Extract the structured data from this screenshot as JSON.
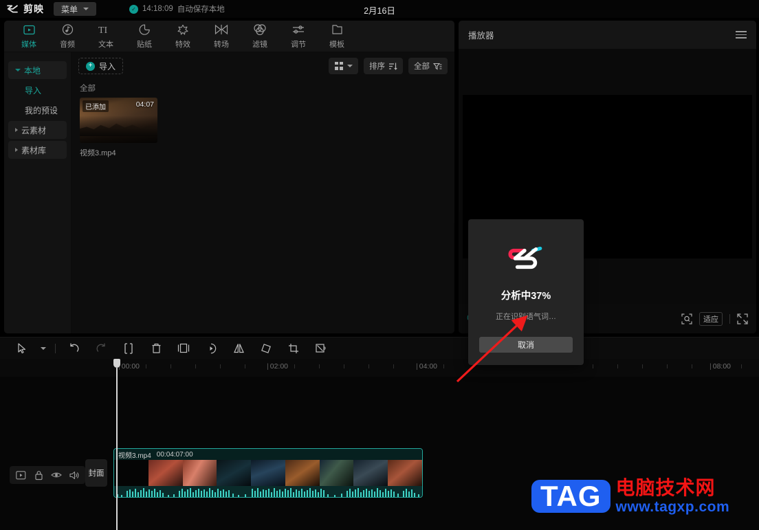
{
  "titlebar": {
    "app_name": "剪映",
    "menu_label": "菜单",
    "save_time": "14:18:09",
    "save_status": "自动保存本地",
    "date": "2月16日"
  },
  "tabs": [
    {
      "label": "媒体",
      "icon": "media-icon",
      "active": true
    },
    {
      "label": "音频",
      "icon": "audio-icon",
      "active": false
    },
    {
      "label": "文本",
      "icon": "text-icon",
      "active": false
    },
    {
      "label": "贴纸",
      "icon": "sticker-icon",
      "active": false
    },
    {
      "label": "特效",
      "icon": "effects-icon",
      "active": false
    },
    {
      "label": "转场",
      "icon": "transition-icon",
      "active": false
    },
    {
      "label": "滤镜",
      "icon": "filter-icon",
      "active": false
    },
    {
      "label": "调节",
      "icon": "adjust-icon",
      "active": false
    },
    {
      "label": "模板",
      "icon": "template-icon",
      "active": false
    }
  ],
  "sidebar": {
    "items": [
      {
        "label": "本地",
        "type": "group",
        "expanded": true
      },
      {
        "label": "导入",
        "type": "item",
        "active": true
      },
      {
        "label": "我的预设",
        "type": "item",
        "active": false
      },
      {
        "label": "云素材",
        "type": "group",
        "expanded": false
      },
      {
        "label": "素材库",
        "type": "group",
        "expanded": false
      }
    ]
  },
  "media_panel": {
    "import_label": "导入",
    "sort_label": "排序",
    "filter_label": "全部",
    "section_label": "全部",
    "items": [
      {
        "name": "视频3.mp4",
        "duration": "04:07",
        "badge": "已添加"
      }
    ]
  },
  "player": {
    "title": "播放器",
    "timecode": "0",
    "fit_label": "适应"
  },
  "timeline": {
    "ruler_ticks": [
      "00:00",
      "02:00",
      "04:00",
      "08:00"
    ],
    "cover_label": "封面",
    "clip": {
      "name": "视频3.mp4",
      "duration": "00:04:07:00"
    }
  },
  "modal": {
    "title": "分析中37%",
    "subtitle": "正在识别语气词…",
    "cancel_label": "取消"
  },
  "watermark": {
    "tag": "TAG",
    "site_cn": "电脑技术网",
    "url": "www.tagxp.com"
  },
  "colors": {
    "accent": "#1aa69b",
    "clip_border": "#24a79c",
    "logo_pink": "#f5254f",
    "logo_cyan": "#18c8e0",
    "watermark_blue": "#1f5ff0",
    "watermark_red": "#f21414",
    "arrow_red": "#ef1b1b"
  }
}
